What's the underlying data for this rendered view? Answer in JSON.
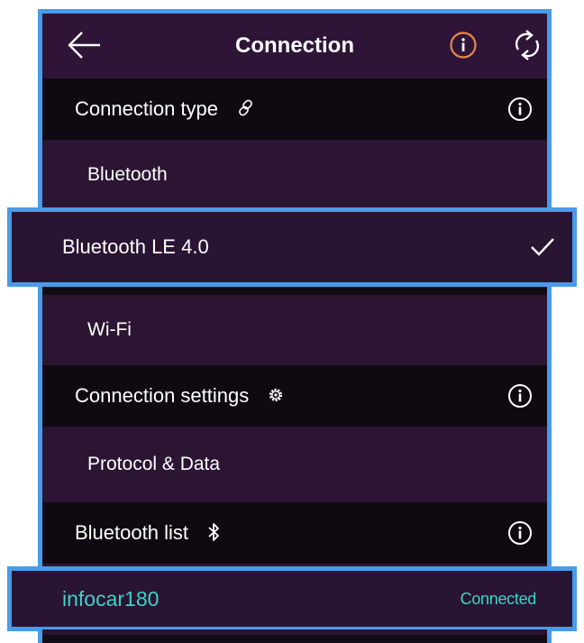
{
  "appbar": {
    "title": "Connection",
    "back_icon": "arrow-left-icon",
    "info_icon": "info-circle-icon",
    "refresh_icon": "refresh-icon",
    "info_accent": "#e8884a"
  },
  "sections": {
    "connection_type": {
      "label": "Connection type",
      "icon": "link-icon"
    },
    "connection_settings": {
      "label": "Connection settings",
      "icon": "gear-icon"
    },
    "bluetooth_list": {
      "label": "Bluetooth list",
      "icon": "bluetooth-icon"
    }
  },
  "connection_types": {
    "bluetooth": "Bluetooth",
    "bluetooth_le": "Bluetooth LE 4.0",
    "wifi": "Wi-Fi"
  },
  "settings": {
    "protocol_data": "Protocol & Data"
  },
  "device": {
    "name": "infocar180",
    "status": "Connected"
  },
  "colors": {
    "highlight": "#4a9be8",
    "background": "#2b1533",
    "section_bg": "#0f0a11",
    "connected": "#3cd4c4"
  }
}
